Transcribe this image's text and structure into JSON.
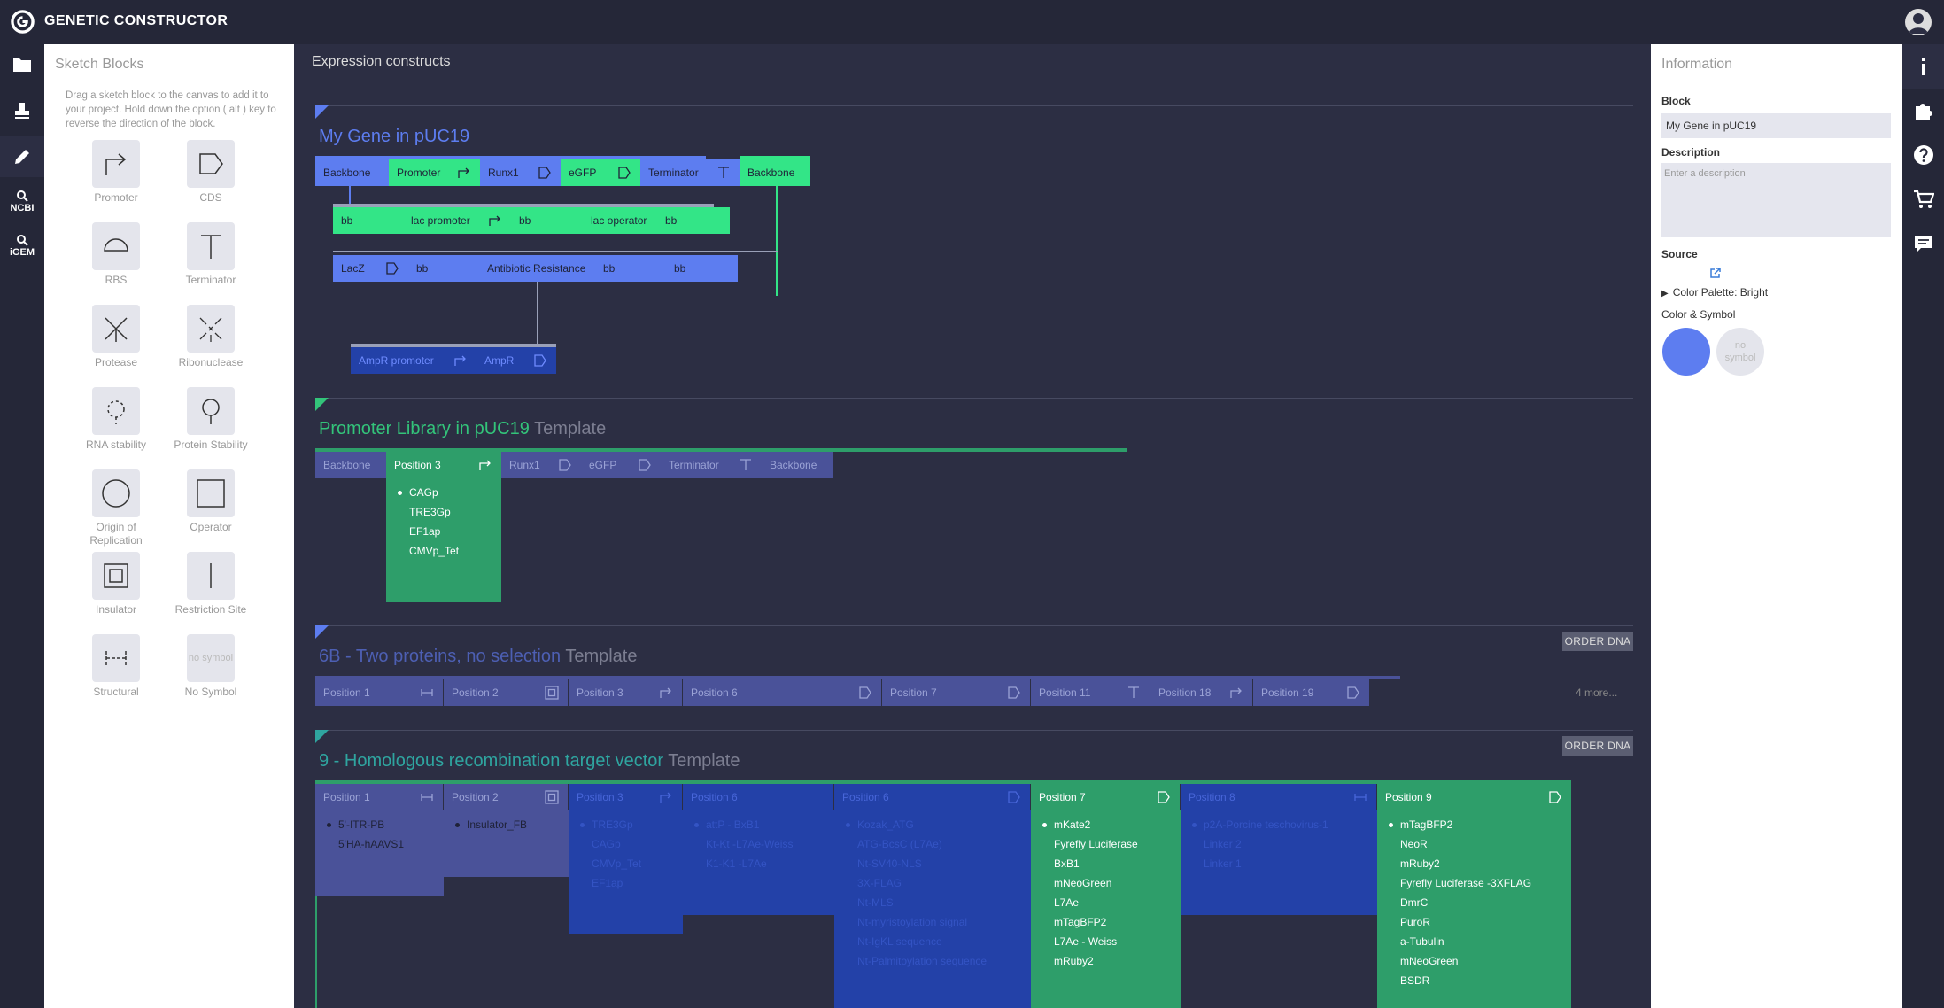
{
  "app": {
    "title": "GENETIC CONSTRUCTOR"
  },
  "left_rail": {
    "ncbi_label": "NCBI",
    "igem_label": "iGEM"
  },
  "sketch": {
    "title": "Sketch Blocks",
    "help": "Drag a sketch block to the canvas to add it to your project. Hold down the option ( alt ) key to reverse the direction of the block.",
    "no_symbol_text": "no symbol",
    "blocks": [
      {
        "label": "Promoter",
        "icon": "promoter-icon"
      },
      {
        "label": "CDS",
        "icon": "cds-icon"
      },
      {
        "label": "RBS",
        "icon": "rbs-icon"
      },
      {
        "label": "Terminator",
        "icon": "terminator-icon"
      },
      {
        "label": "Protease",
        "icon": "protease-icon"
      },
      {
        "label": "Ribonuclease",
        "icon": "ribonuclease-icon"
      },
      {
        "label": "RNA stability",
        "icon": "rna-stability-icon"
      },
      {
        "label": "Protein Stability",
        "icon": "protein-stability-icon"
      },
      {
        "label": "Origin of Replication",
        "icon": "origin-icon"
      },
      {
        "label": "Operator",
        "icon": "operator-icon"
      },
      {
        "label": "Insulator",
        "icon": "insulator-icon"
      },
      {
        "label": "Restriction Site",
        "icon": "restriction-site-icon"
      },
      {
        "label": "Structural",
        "icon": "structural-icon"
      },
      {
        "label": "No Symbol",
        "icon": "no-symbol-icon"
      }
    ]
  },
  "main": {
    "title": "Expression constructs",
    "template_word": "Template",
    "order_label": "ORDER DNA",
    "colors": {
      "blue": "#5d7df0",
      "green": "#33e587",
      "dark_green": "#2e9e6a",
      "slate": "#4a5299",
      "navy": "#2341a8"
    },
    "c1": {
      "name": "My Gene in pUC19",
      "row1": [
        "Backbone",
        "Promoter",
        "Runx1",
        "eGFP",
        "Terminator",
        "Backbone"
      ],
      "row2": [
        "bb",
        "lac promoter",
        "bb",
        "lac operator",
        "bb"
      ],
      "row3": [
        "LacZ",
        "bb",
        "Antibiotic Resistance",
        "bb",
        "bb"
      ],
      "row4": [
        "AmpR promoter",
        "AmpR"
      ]
    },
    "c2": {
      "name": "Promoter Library in pUC19",
      "parts": [
        "Backbone",
        "Position 3",
        "Runx1",
        "eGFP",
        "Terminator",
        "Backbone"
      ],
      "options": [
        "CAGp",
        "TRE3Gp",
        "EF1ap",
        "CMVp_Tet"
      ]
    },
    "c3": {
      "name": "6B - Two proteins, no selection",
      "parts": [
        "Position 1",
        "Position 2",
        "Position 3",
        "Position 6",
        "Position 7",
        "Position 11",
        "Position 18",
        "Position 19"
      ],
      "more": "4 more..."
    },
    "c4": {
      "name": "9 - Homologous recombination target vector",
      "parts": [
        "Position 1",
        "Position 2",
        "Position 3",
        "Position 6",
        "Position 6",
        "Position 7",
        "Position 8",
        "Position 9"
      ],
      "lists": [
        [
          "5'-ITR-PB",
          "5'HA-hAAVS1"
        ],
        [
          "Insulator_FB"
        ],
        [
          "TRE3Gp",
          "CAGp",
          "CMVp_Tet",
          "EF1ap"
        ],
        [
          "attP - BxB1",
          "Kt-Kt -L7Ae-Weiss",
          "K1-K1 -L7Ae"
        ],
        [
          "Kozak_ATG",
          "ATG-BcsC (L7Ae)",
          "Nt-SV40-NLS",
          "3X-FLAG",
          "Nt-MLS",
          "Nt-myristoylation signal",
          "Nt-IgKL sequence",
          "Nt-Palmitoylation sequence"
        ],
        [
          "mKate2",
          "Fyrefly Luciferase",
          "BxB1",
          "mNeoGreen",
          "L7Ae",
          "mTagBFP2",
          "L7Ae - Weiss",
          "mRuby2"
        ],
        [
          "p2A-Porcine teschovirus-1",
          "Linker 2",
          "Linker 1"
        ],
        [
          "mTagBFP2",
          "NeoR",
          "mRuby2",
          "Fyrefly Luciferase -3XFLAG",
          "DmrC",
          "PuroR",
          "a-Tubulin",
          "mNeoGreen",
          "BSDR"
        ]
      ]
    }
  },
  "info": {
    "title": "Information",
    "block_label": "Block",
    "block_value": "My Gene in pUC19",
    "description_label": "Description",
    "description_placeholder": "Enter a description",
    "source_label": "Source",
    "palette": "Color Palette: Bright",
    "color_symbol_label": "Color & Symbol",
    "selected_color": "#5d7df0",
    "no_symbol": "no symbol"
  }
}
